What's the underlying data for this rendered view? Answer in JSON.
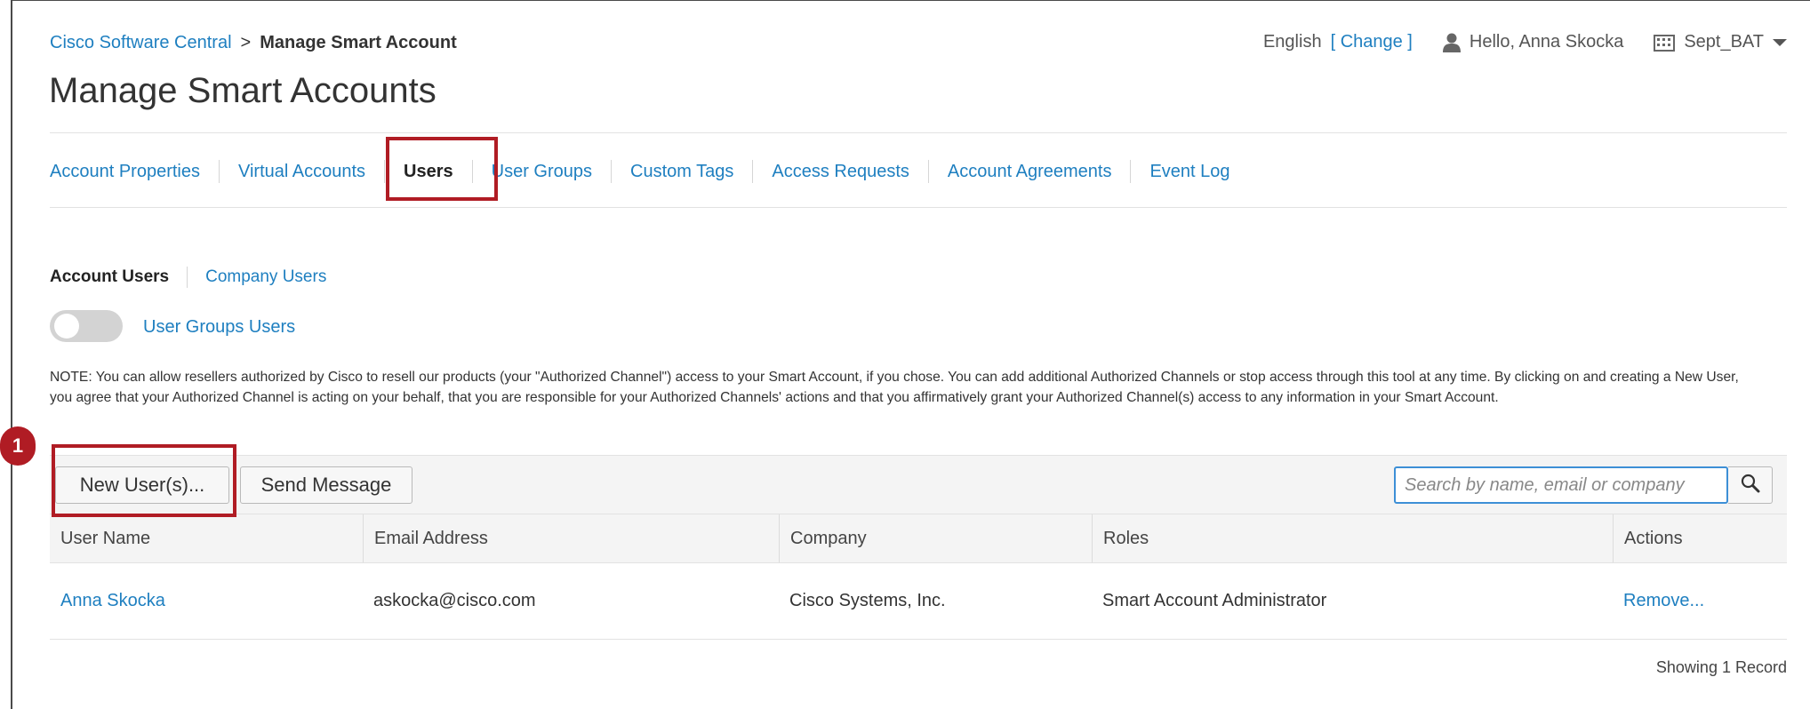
{
  "breadcrumb": {
    "root": "Cisco Software Central",
    "separator": ">",
    "current": "Manage Smart Account"
  },
  "page_title": "Manage Smart Accounts",
  "user_bar": {
    "language": "English",
    "change_label": "[ Change ]",
    "greeting": "Hello, Anna Skocka",
    "account": "Sept_BAT"
  },
  "tabs": [
    {
      "label": "Account Properties"
    },
    {
      "label": "Virtual Accounts"
    },
    {
      "label": "Users",
      "active": true
    },
    {
      "label": "User Groups"
    },
    {
      "label": "Custom Tags"
    },
    {
      "label": "Access Requests"
    },
    {
      "label": "Account Agreements"
    },
    {
      "label": "Event Log"
    }
  ],
  "subtabs": [
    {
      "label": "Account Users",
      "active": true
    },
    {
      "label": "Company Users"
    }
  ],
  "toggle": {
    "label": "User Groups Users",
    "on": false
  },
  "note": "NOTE: You can allow resellers authorized by Cisco to resell our products (your \"Authorized Channel\") access to your Smart Account, if you chose. You can add additional Authorized Channels or stop access through this tool at any time. By clicking on and creating a New User, you agree that your Authorized Channel is acting on your behalf, that you are responsible for your Authorized Channels' actions and that you affirmatively grant your Authorized Channel(s) access to any information in your Smart Account.",
  "toolbar": {
    "new_users_label": "New User(s)...",
    "send_message_label": "Send Message",
    "search_placeholder": "Search by name, email or company"
  },
  "table": {
    "columns": [
      "User Name",
      "Email Address",
      "Company",
      "Roles",
      "Actions"
    ],
    "rows": [
      {
        "user_name": "Anna Skocka",
        "email": "askocka@cisco.com",
        "company": "Cisco Systems, Inc.",
        "roles": "Smart Account Administrator",
        "action": "Remove..."
      }
    ]
  },
  "record_count": "Showing 1 Record",
  "annotation": {
    "step_number": "1",
    "color": "#b01c24"
  },
  "colors": {
    "link": "#1e7fc0",
    "highlight": "#b01c24",
    "search_focus": "#3d8fd6"
  }
}
